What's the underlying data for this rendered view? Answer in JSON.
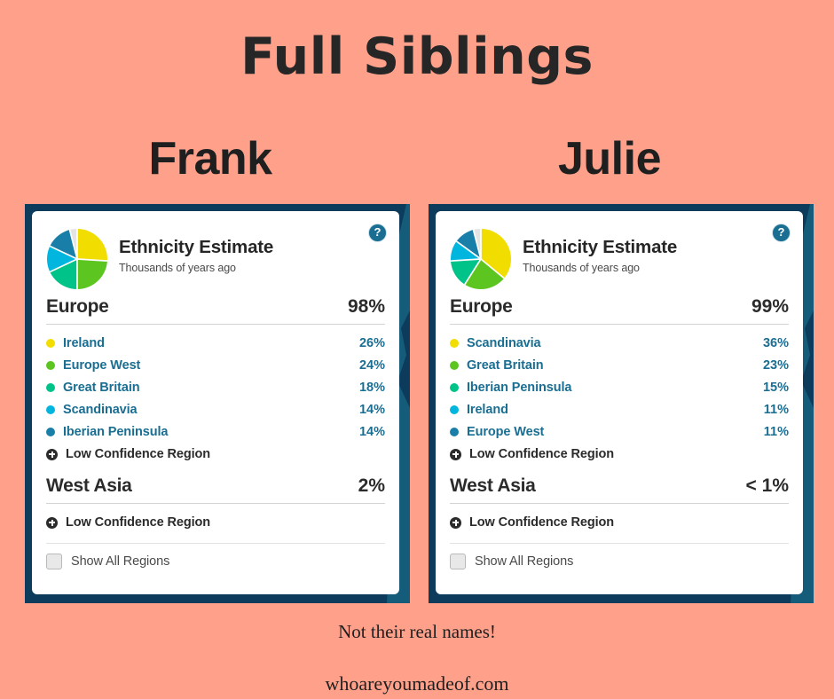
{
  "title": "Full Siblings",
  "footer": {
    "note": "Not their real names!",
    "site": "whoareyoumadeof.com"
  },
  "colors": {
    "background": "#ffa08a",
    "frame": "#0d3b5c",
    "frame_accent": "#17627f",
    "card": "#ffffff",
    "link_blue": "#1a6e92",
    "heading": "#2b2b2b",
    "slice_yellow": "#f2dd00",
    "slice_green": "#5cc520",
    "slice_spring": "#00c389",
    "slice_cyan": "#00b6de",
    "slice_teal": "#1a7fa8",
    "slice_grey": "#e4e4e4"
  },
  "cards": [
    {
      "person": "Frank",
      "help_icon": "question-mark-icon",
      "header": {
        "title": "Ethnicity Estimate",
        "subtitle": "Thousands of years ago"
      },
      "pie": {
        "slices": [
          {
            "label": "Ireland",
            "value": 26,
            "color": "#f2dd00"
          },
          {
            "label": "Europe West",
            "value": 24,
            "color": "#5cc520"
          },
          {
            "label": "Great Britain",
            "value": 18,
            "color": "#00c389"
          },
          {
            "label": "Scandinavia",
            "value": 14,
            "color": "#00b6de"
          },
          {
            "label": "Iberian Peninsula",
            "value": 14,
            "color": "#1a7fa8"
          },
          {
            "label": "Other",
            "value": 4,
            "color": "#e4e4e4"
          }
        ]
      },
      "sections": [
        {
          "name": "Europe",
          "percent": "98%",
          "subregions": [
            {
              "label": "Ireland",
              "percent": "26%",
              "color": "#f2dd00"
            },
            {
              "label": "Europe West",
              "percent": "24%",
              "color": "#5cc520"
            },
            {
              "label": "Great Britain",
              "percent": "18%",
              "color": "#00c389"
            },
            {
              "label": "Scandinavia",
              "percent": "14%",
              "color": "#00b6de"
            },
            {
              "label": "Iberian Peninsula",
              "percent": "14%",
              "color": "#1a7fa8"
            }
          ],
          "low_confidence_label": "Low Confidence Region"
        },
        {
          "name": "West Asia",
          "percent": "2%",
          "subregions": [],
          "low_confidence_label": "Low Confidence Region"
        }
      ],
      "show_all_label": "Show All Regions"
    },
    {
      "person": "Julie",
      "help_icon": "question-mark-icon",
      "header": {
        "title": "Ethnicity Estimate",
        "subtitle": "Thousands of years ago"
      },
      "pie": {
        "slices": [
          {
            "label": "Scandinavia",
            "value": 36,
            "color": "#f2dd00"
          },
          {
            "label": "Great Britain",
            "value": 23,
            "color": "#5cc520"
          },
          {
            "label": "Iberian Peninsula",
            "value": 15,
            "color": "#00c389"
          },
          {
            "label": "Ireland",
            "value": 11,
            "color": "#00b6de"
          },
          {
            "label": "Europe West",
            "value": 11,
            "color": "#1a7fa8"
          },
          {
            "label": "Other",
            "value": 4,
            "color": "#e4e4e4"
          }
        ]
      },
      "sections": [
        {
          "name": "Europe",
          "percent": "99%",
          "subregions": [
            {
              "label": "Scandinavia",
              "percent": "36%",
              "color": "#f2dd00"
            },
            {
              "label": "Great Britain",
              "percent": "23%",
              "color": "#5cc520"
            },
            {
              "label": "Iberian Peninsula",
              "percent": "15%",
              "color": "#00c389"
            },
            {
              "label": "Ireland",
              "percent": "11%",
              "color": "#00b6de"
            },
            {
              "label": "Europe West",
              "percent": "11%",
              "color": "#1a7fa8"
            }
          ],
          "low_confidence_label": "Low Confidence Region"
        },
        {
          "name": "West Asia",
          "percent": "< 1%",
          "subregions": [],
          "low_confidence_label": "Low Confidence Region"
        }
      ],
      "show_all_label": "Show All Regions"
    }
  ],
  "chart_data": {
    "type": "pie",
    "title": "Ethnicity Estimate",
    "charts": [
      {
        "name": "Frank",
        "labels": [
          "Ireland",
          "Europe West",
          "Great Britain",
          "Scandinavia",
          "Iberian Peninsula",
          "Other"
        ],
        "values": [
          26,
          24,
          18,
          14,
          14,
          4
        ],
        "colors": [
          "#f2dd00",
          "#5cc520",
          "#00c389",
          "#00b6de",
          "#1a7fa8",
          "#e4e4e4"
        ],
        "totals": {
          "Europe": "98%",
          "West Asia": "2%"
        }
      },
      {
        "name": "Julie",
        "labels": [
          "Scandinavia",
          "Great Britain",
          "Iberian Peninsula",
          "Ireland",
          "Europe West",
          "Other"
        ],
        "values": [
          36,
          23,
          15,
          11,
          11,
          4
        ],
        "colors": [
          "#f2dd00",
          "#5cc520",
          "#00c389",
          "#00b6de",
          "#1a7fa8",
          "#e4e4e4"
        ],
        "totals": {
          "Europe": "99%",
          "West Asia": "< 1%"
        }
      }
    ],
    "legend_position": "list-below"
  }
}
